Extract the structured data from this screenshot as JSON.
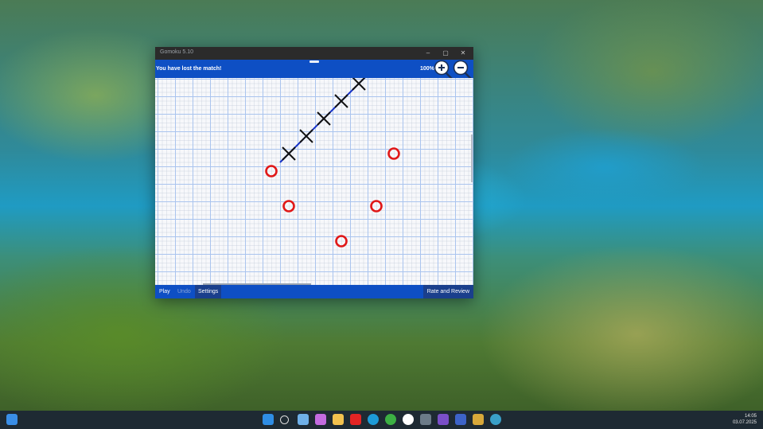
{
  "window": {
    "title": "Gomoku 5.10",
    "controls": {
      "minimize": "–",
      "maximize": "▢",
      "close": "✕"
    }
  },
  "toolbar": {
    "status": "You have lost the match!",
    "zoom": "100%",
    "zoom_in_icon": "zoom-in-icon",
    "zoom_out_icon": "zoom-out-icon"
  },
  "board": {
    "cols": 18,
    "rows": 12,
    "x_marks": [
      [
        7,
        4
      ],
      [
        8,
        3
      ],
      [
        9,
        2
      ],
      [
        10,
        1
      ],
      [
        11,
        0
      ]
    ],
    "o_marks": [
      [
        6,
        5
      ],
      [
        7,
        7
      ],
      [
        13,
        4
      ],
      [
        12,
        7
      ],
      [
        10,
        9
      ]
    ],
    "win_line_color": "#1530c8",
    "o_color": "#e01818",
    "x_color": "#111111"
  },
  "bottombar": {
    "play": "Play",
    "undo": "Undo",
    "settings": "Settings",
    "rate": "Rate and Review"
  },
  "taskbar": {
    "time": "14:05",
    "date": "03.07.2025",
    "icons": [
      "widgets-icon",
      "start-icon",
      "search-icon",
      "files-icon",
      "copilot-icon",
      "explorer-icon",
      "youtube-icon",
      "edge-icon",
      "chrome-icon",
      "yandex-icon",
      "settings-icon",
      "visual-studio-icon",
      "save-icon",
      "photos-icon",
      "browser-icon"
    ]
  }
}
